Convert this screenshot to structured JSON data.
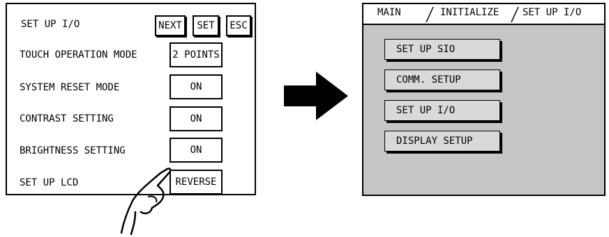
{
  "left_panel": {
    "title": "SET UP I/O",
    "buttons": {
      "next": "NEXT",
      "set": "SET",
      "esc": "ESC"
    },
    "rows": [
      {
        "label": "TOUCH OPERATION MODE",
        "value": "2 POINTS"
      },
      {
        "label": "SYSTEM RESET MODE",
        "value": "ON"
      },
      {
        "label": "CONTRAST SETTING",
        "value": "ON"
      },
      {
        "label": "BRIGHTNESS SETTING",
        "value": "ON"
      },
      {
        "label": "SET UP LCD",
        "value": "REVERSE"
      }
    ]
  },
  "icons": {
    "arrow": "right-arrow-icon",
    "hand": "pointing-hand-icon"
  },
  "right_panel": {
    "tabs": [
      "MAIN",
      "INITIALIZE",
      "SET UP I/O"
    ],
    "menu": [
      "SET UP SIO",
      "COMM. SETUP",
      "SET UP I/O",
      "DISPLAY SETUP"
    ]
  },
  "colors": {
    "panel_background": "#c6c6c6",
    "button_face": "#d9d9d9"
  }
}
